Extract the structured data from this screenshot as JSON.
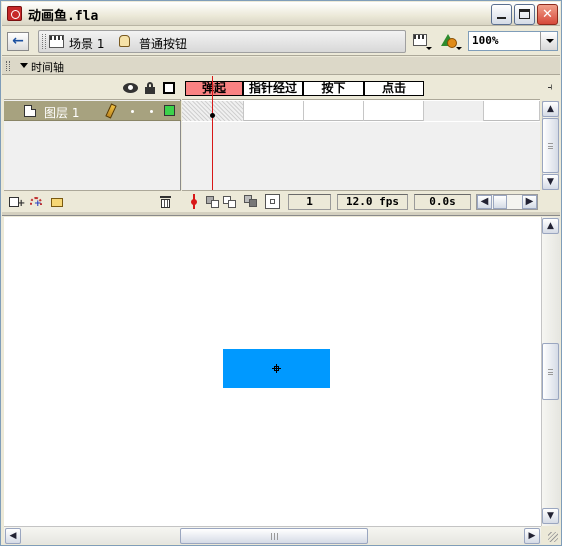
{
  "window": {
    "title": "动画鱼.fla",
    "minimize_glyph": "",
    "close_glyph": "✕"
  },
  "editbar": {
    "back_icon": "←",
    "scene_label": "场景 1",
    "symbol_label": "普通按钮",
    "zoom": "100%"
  },
  "timeline": {
    "title": "时间轴",
    "layer_name": "图层 1",
    "layer_color": "#3bd24b",
    "frames": [
      "弹起",
      "指针经过",
      "按下",
      "点击"
    ],
    "active_frame_index": 0,
    "current_frame": "1",
    "frame_rate": "12.0 fps",
    "elapsed_time": "0.0s",
    "menu_icon": "⫞"
  },
  "stage": {
    "button_fill": "#0099ff"
  },
  "scroll": {
    "up": "▲",
    "down": "▼",
    "left": "◀",
    "right": "▶"
  }
}
